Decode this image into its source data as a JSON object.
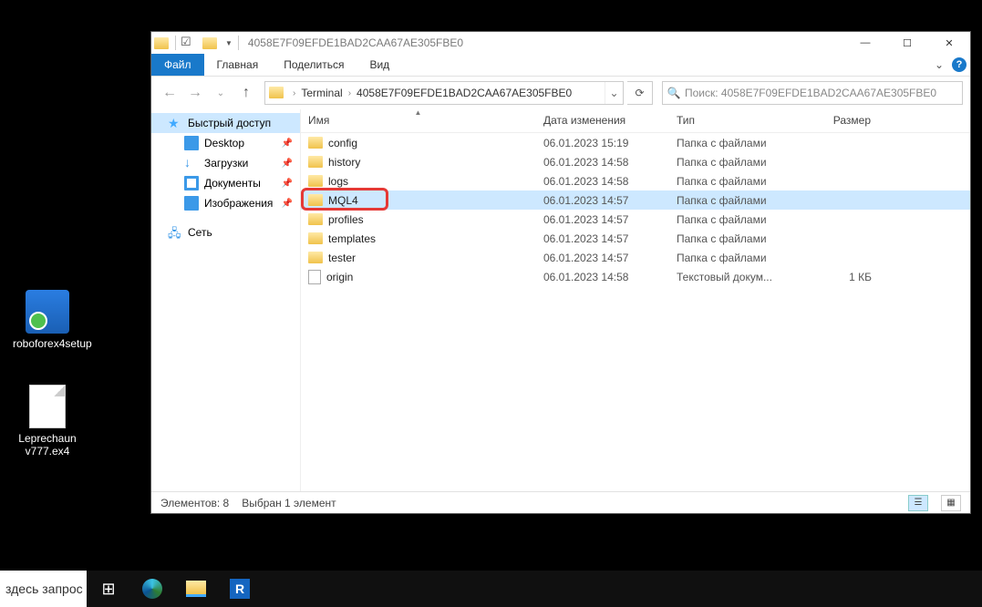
{
  "desktop": {
    "icons": [
      {
        "name": "roboforex4setup",
        "kind": "installer"
      },
      {
        "name": "Leprechaun v777.ex4",
        "kind": "file"
      }
    ]
  },
  "window": {
    "title": "4058E7F09EFDE1BAD2CAA67AE305FBE0",
    "ribbon": {
      "file": "Файл",
      "tabs": [
        "Главная",
        "Поделиться",
        "Вид"
      ]
    },
    "address": {
      "crumbs": [
        "Terminal",
        "4058E7F09EFDE1BAD2CAA67AE305FBE0"
      ],
      "search_placeholder": "Поиск: 4058E7F09EFDE1BAD2CAA67AE305FBE0"
    },
    "nav": {
      "quick": "Быстрый доступ",
      "items": [
        "Desktop",
        "Загрузки",
        "Документы",
        "Изображения"
      ],
      "network": "Сеть"
    },
    "columns": {
      "name": "Имя",
      "date": "Дата изменения",
      "type": "Тип",
      "size": "Размер"
    },
    "rows": [
      {
        "name": "config",
        "date": "06.01.2023 15:19",
        "type": "Папка с файлами",
        "size": "",
        "icon": "folder"
      },
      {
        "name": "history",
        "date": "06.01.2023 14:58",
        "type": "Папка с файлами",
        "size": "",
        "icon": "folder"
      },
      {
        "name": "logs",
        "date": "06.01.2023 14:58",
        "type": "Папка с файлами",
        "size": "",
        "icon": "folder"
      },
      {
        "name": "MQL4",
        "date": "06.01.2023 14:57",
        "type": "Папка с файлами",
        "size": "",
        "icon": "folder",
        "selected": true,
        "highlighted": true
      },
      {
        "name": "profiles",
        "date": "06.01.2023 14:57",
        "type": "Папка с файлами",
        "size": "",
        "icon": "folder"
      },
      {
        "name": "templates",
        "date": "06.01.2023 14:57",
        "type": "Папка с файлами",
        "size": "",
        "icon": "folder"
      },
      {
        "name": "tester",
        "date": "06.01.2023 14:57",
        "type": "Папка с файлами",
        "size": "",
        "icon": "folder"
      },
      {
        "name": "origin",
        "date": "06.01.2023 14:58",
        "type": "Текстовый докум...",
        "size": "1 КБ",
        "icon": "txt"
      }
    ],
    "status": {
      "count": "Элементов: 8",
      "selection": "Выбран 1 элемент"
    }
  },
  "taskbar": {
    "search": "здесь запрос",
    "app_letter": "R"
  }
}
